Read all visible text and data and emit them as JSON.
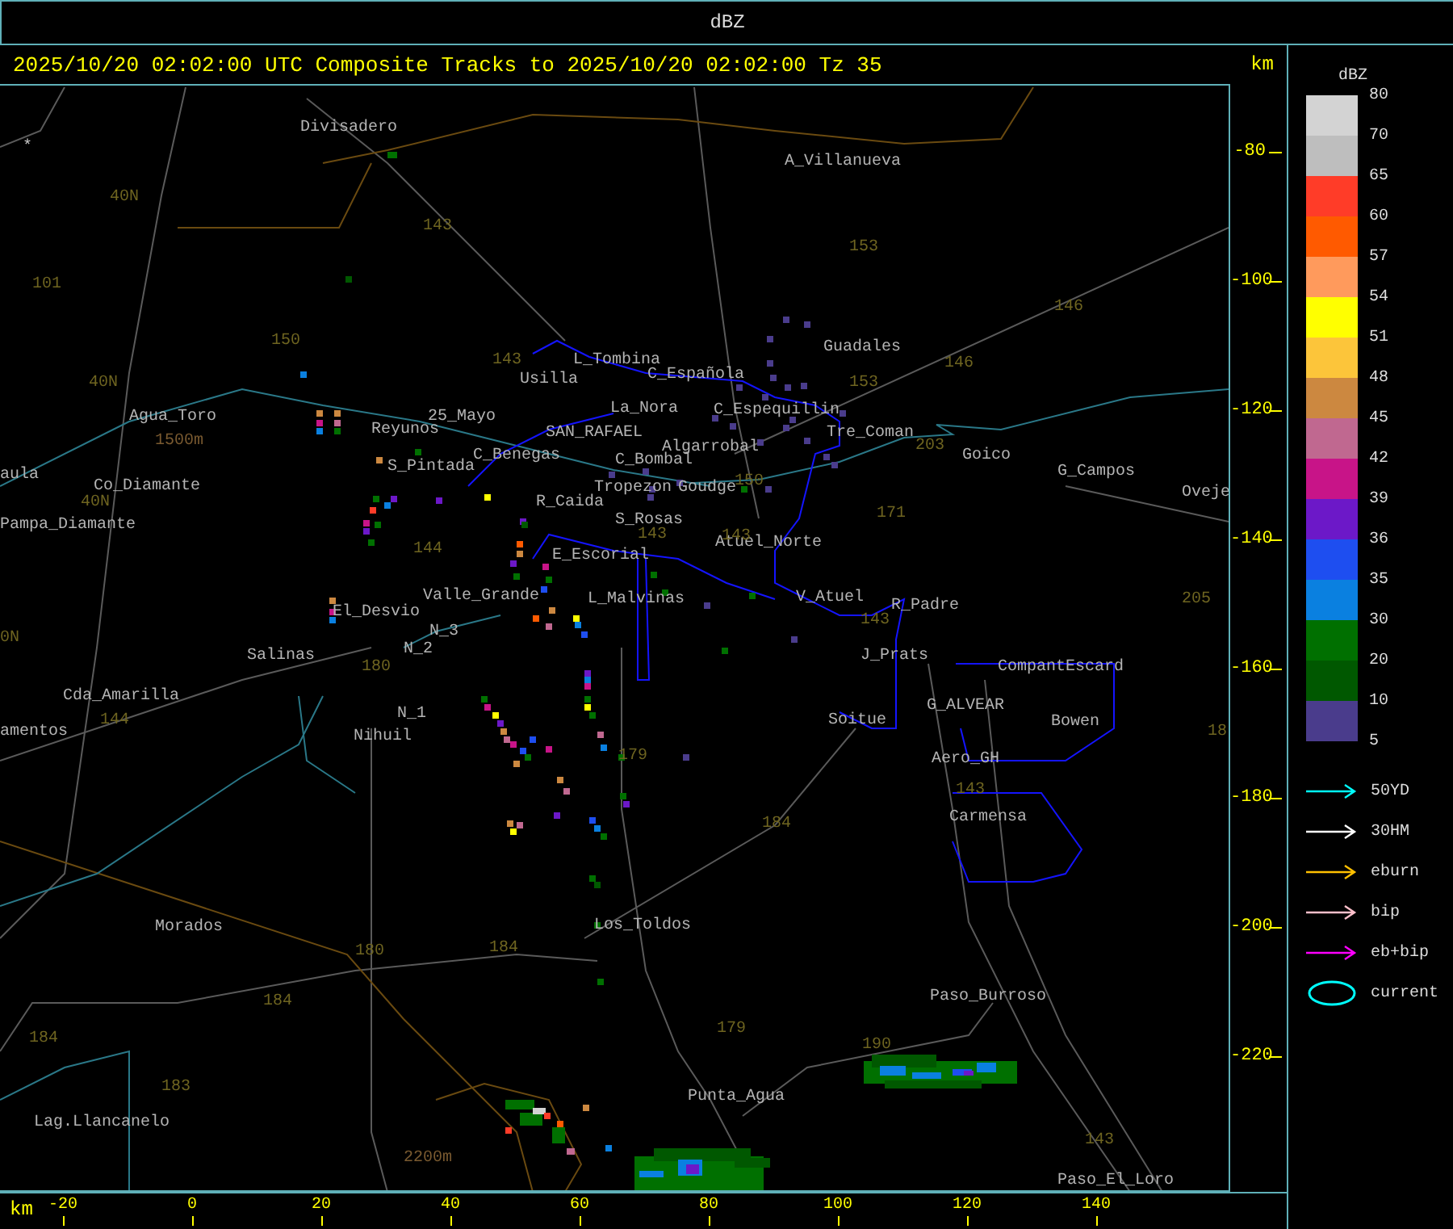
{
  "window": {
    "title": "dBZ"
  },
  "header": {
    "title": "2025/10/20 02:02:00 UTC Composite Tracks to 2025/10/20 02:02:00 Tz 35",
    "units": "km"
  },
  "map": {
    "marker": "*",
    "places": [
      "Divisadero",
      "A_Villanueva",
      "Guadales",
      "L_Tombina",
      "C_Española",
      "Usilla",
      "La_Nora",
      "C_Espequillin",
      "Tre_Coman",
      "25_Mayo",
      "Reyunos",
      "C_Benegas",
      "SAN_RAFAEL",
      "Algarrobal",
      "C_Bombal",
      "S_Pintada",
      "Tropezon",
      "Goudge",
      "R_Caida",
      "S_Rosas",
      "Atuel_Norte",
      "E_Escorial",
      "Valle_Grande",
      "L_Malvinas",
      "El_Desvio",
      "V_Atuel",
      "R_Padre",
      "N_3",
      "N_2",
      "Salinas",
      "J_Prats",
      "CompantEscard",
      "Cda_Amarilla",
      "G_ALVEAR",
      "N_1",
      "Nihuil",
      "Soitue",
      "Bowen",
      "amentos",
      "Aero_GH",
      "Carmensa",
      "Morados",
      "Los_Toldos",
      "Paso_Burroso",
      "Punta_Agua",
      "Lag.Llancanelo",
      "Paso_El_Loro",
      "Goico",
      "G_Campos",
      "Oveje",
      "Pampa_Diamante",
      "Agua_Toro",
      "Co_Diamante",
      "aula"
    ],
    "road_numbers": [
      "40N",
      "101",
      "143",
      "150",
      "143",
      "40N",
      "40N",
      "144",
      "153",
      "146",
      "153",
      "146",
      "203",
      "150",
      "171",
      "143",
      "143",
      "143",
      "205",
      "180",
      "0N",
      "144",
      "179",
      "184",
      "180",
      "184",
      "184",
      "184",
      "183",
      "179",
      "190",
      "143",
      "143",
      "18"
    ],
    "elevations": [
      "1500m",
      "2200m"
    ]
  },
  "y_axis": {
    "ticks": [
      "-80",
      "-100",
      "-120",
      "-140",
      "-160",
      "-180",
      "-200",
      "-220"
    ]
  },
  "x_axis": {
    "unit": "km",
    "ticks": [
      "-20",
      "0",
      "20",
      "40",
      "60",
      "80",
      "100",
      "120",
      "140"
    ]
  },
  "legend": {
    "unit": "dBZ",
    "bands": [
      {
        "label": "80",
        "color": "#d3d3d3"
      },
      {
        "label": "70",
        "color": "#bebebe"
      },
      {
        "label": "65",
        "color": "#ff3c28"
      },
      {
        "label": "60",
        "color": "#ff5a00"
      },
      {
        "label": "57",
        "color": "#ff9a5c"
      },
      {
        "label": "54",
        "color": "#ffff00"
      },
      {
        "label": "51",
        "color": "#fcc53a"
      },
      {
        "label": "48",
        "color": "#cc8840"
      },
      {
        "label": "45",
        "color": "#c06890"
      },
      {
        "label": "42",
        "color": "#c81488"
      },
      {
        "label": "39",
        "color": "#6c18c8"
      },
      {
        "label": "36",
        "color": "#1e4ef0"
      },
      {
        "label": "35",
        "color": "#0a80e0"
      },
      {
        "label": "30",
        "color": "#007000"
      },
      {
        "label": "20",
        "color": "#005800"
      },
      {
        "label": "10",
        "color": "#4a3c8c"
      }
    ],
    "bottom_label": "5",
    "tracks": [
      {
        "label": "50YD",
        "kind": "arrow",
        "color": "#00ffff"
      },
      {
        "label": "30HM",
        "kind": "arrow",
        "color": "#ffffff"
      },
      {
        "label": "eburn",
        "kind": "arrow",
        "color": "#ffc000"
      },
      {
        "label": "bip",
        "kind": "arrow",
        "color": "#ffc0cb"
      },
      {
        "label": "eb+bip",
        "kind": "arrow",
        "color": "#ff00ff"
      },
      {
        "label": "current",
        "kind": "ellipse",
        "color": "#00ffff"
      }
    ]
  }
}
